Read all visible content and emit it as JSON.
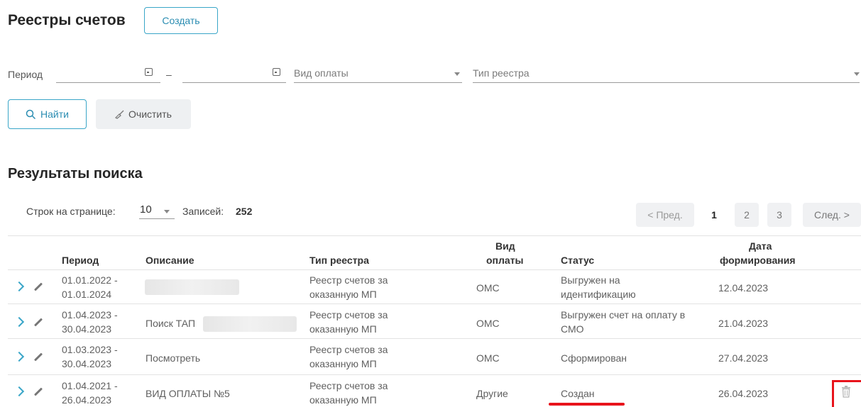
{
  "header": {
    "title": "Реестры счетов",
    "create_label": "Создать"
  },
  "filters": {
    "period_label": "Период",
    "dash": "–",
    "payment_type_placeholder": "Вид оплаты",
    "registry_type_placeholder": "Тип реестра",
    "find_label": "Найти",
    "clear_label": "Очистить"
  },
  "results": {
    "title": "Результаты поиска",
    "rows_per_page_label": "Строк на странице:",
    "rows_per_page_value": "10",
    "records_label": "Записей:",
    "records_count": "252",
    "pager": {
      "prev": "< Пред.",
      "pages": [
        "1",
        "2",
        "3"
      ],
      "next": "След. >"
    }
  },
  "table": {
    "headers": {
      "period": "Период",
      "description": "Описание",
      "registry_type": "Тип реестра",
      "payment_type_1": "Вид",
      "payment_type_2": "оплаты",
      "status": "Статус",
      "date_1": "Дата",
      "date_2": "формирования"
    },
    "rows": [
      {
        "period_1": "01.01.2022 -",
        "period_2": "01.01.2024",
        "description": "",
        "registry_1": "Реестр счетов за",
        "registry_2": "оказанную МП",
        "payment": "ОМС",
        "status_1": "Выгружен на",
        "status_2": "идентификацию",
        "date": "12.04.2023"
      },
      {
        "period_1": "01.04.2023 -",
        "period_2": "30.04.2023",
        "description": "Поиск ТАП",
        "registry_1": "Реестр счетов за",
        "registry_2": "оказанную МП",
        "payment": "ОМС",
        "status_1": "Выгружен счет на оплату в",
        "status_2": "СМО",
        "date": "21.04.2023"
      },
      {
        "period_1": "01.03.2023 -",
        "period_2": "30.04.2023",
        "description": "Посмотреть",
        "registry_1": "Реестр счетов за",
        "registry_2": "оказанную МП",
        "payment": "ОМС",
        "status_1": "Сформирован",
        "status_2": "",
        "date": "27.04.2023"
      },
      {
        "period_1": "01.04.2021 -",
        "period_2": "26.04.2023",
        "description": "ВИД ОПЛАТЫ №5",
        "registry_1": "Реестр счетов за",
        "registry_2": "оказанную МП",
        "payment": "Другие",
        "status_1": "Создан",
        "status_2": "",
        "date": "26.04.2023"
      }
    ]
  },
  "colors": {
    "accent": "#3aa6c8",
    "highlight": "#e8141c"
  }
}
